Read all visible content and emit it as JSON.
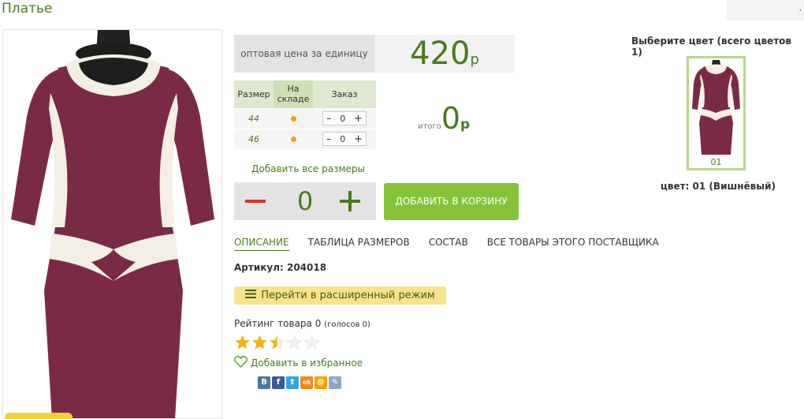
{
  "page": {
    "title": "Платье"
  },
  "top_right": {
    "text": "⸱"
  },
  "price": {
    "label": "оптовая цена за единицу",
    "value": "420",
    "currency": "р"
  },
  "size_table": {
    "headers": {
      "size": "Размер",
      "stock": "На складе",
      "order": "Заказ"
    },
    "rows": [
      {
        "size": "44",
        "qty": "0",
        "minus": "–",
        "plus": "+"
      },
      {
        "size": "46",
        "qty": "0",
        "minus": "–",
        "plus": "+"
      }
    ]
  },
  "total": {
    "label": "итого",
    "value": "0",
    "currency": "р"
  },
  "add_all_sizes": "Добавить все размеры",
  "quantity": {
    "value": "0"
  },
  "add_to_cart": "ДОБАВИТЬ В КОРЗИНУ",
  "tabs": [
    {
      "label": "ОПИСАНИЕ",
      "active": true
    },
    {
      "label": "ТАБЛИЦА РАЗМЕРОВ",
      "active": false
    },
    {
      "label": "СОСТАВ",
      "active": false
    },
    {
      "label": "ВСЕ ТОВАРЫ ЭТОГО ПОСТАВЩИКА",
      "active": false
    }
  ],
  "article": "Артикул: 204018",
  "extended_mode": "Перейти в расширенный режим",
  "rating": {
    "text": "Рейтинг товара 0",
    "votes": "(голосов 0)",
    "stars_filled": 2.5,
    "stars_total": 5
  },
  "favorite": "Добавить в избранное",
  "socials": [
    {
      "icon": "vk-icon",
      "letter": "В",
      "color": "#4c75a3"
    },
    {
      "icon": "facebook-icon",
      "letter": "f",
      "color": "#3b5998"
    },
    {
      "icon": "twitter-icon",
      "letter": "t",
      "color": "#2ea7e0"
    },
    {
      "icon": "odnoklassniki-icon",
      "letter": "ok",
      "color": "#f2891f"
    },
    {
      "icon": "mailru-icon",
      "letter": "@",
      "color": "#f4a100"
    },
    {
      "icon": "livejournal-icon",
      "letter": "✎",
      "color": "#8ca7c5"
    }
  ],
  "colors": {
    "title": "Выберите цвет (всего цветов 1)",
    "swatch_code": "01",
    "selected": "цвет: 01 (Вишнёвый)"
  },
  "accent": {
    "green": "#4a7a1c",
    "button": "#85c33a",
    "dress": "#7b2a45",
    "trim": "#f4efe4"
  }
}
